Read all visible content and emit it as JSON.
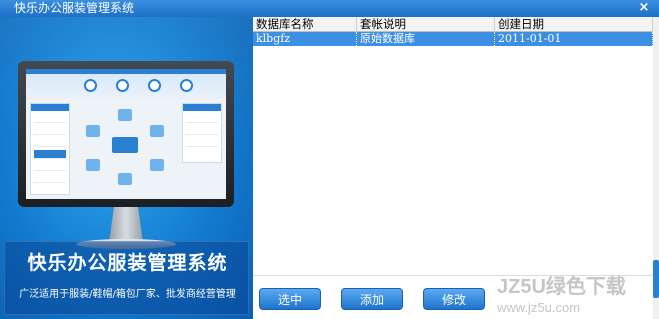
{
  "window": {
    "title": "快乐办公服装管理系统",
    "close_glyph": "×"
  },
  "brand": {
    "title": "快乐办公服装管理系统",
    "subtitle": "广泛适用于服装/鞋帽/箱包厂家、批发商经营管理"
  },
  "grid": {
    "columns": [
      "数据库名称",
      "套帐说明",
      "创建日期"
    ],
    "rows": [
      {
        "name": "klbgfz",
        "description": "原始数据库",
        "created": "2011-01-01",
        "selected": true
      }
    ]
  },
  "buttons": {
    "select_label": "选中",
    "add_label": "添加",
    "edit_label": "修改"
  },
  "watermark": {
    "text": "JZ5U绿色下载",
    "url": "www.jz5u.com"
  },
  "colors": {
    "titlebar": "#2a7fd0",
    "selection": "#3d8fe4",
    "button": "#1f73cd"
  }
}
